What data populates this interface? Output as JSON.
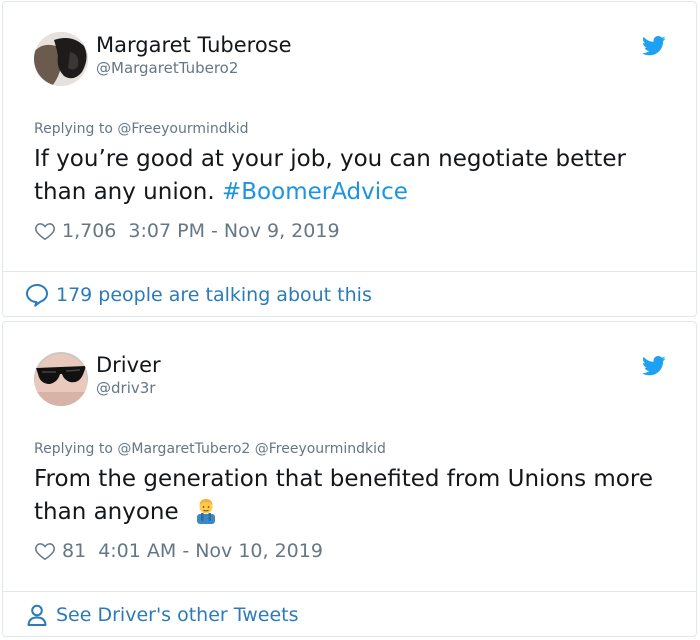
{
  "tweets": [
    {
      "display_name": "Margaret Tuberose",
      "handle": "@MargaretTubero2",
      "replying_label": "Replying to",
      "replying_to": "@Freeyourmindkid",
      "text": "If you’re good at your job, you can negotiate better than any union.",
      "hashtag": "#BoomerAdvice",
      "likes": "1,706",
      "timestamp": "3:07 PM - Nov 9, 2019",
      "footer": "179 people are talking about this",
      "footer_icon": "speech-bubble-icon"
    },
    {
      "display_name": "Driver",
      "handle": "@driv3r",
      "replying_label": "Replying to",
      "replying_to": "@MargaretTubero2 @Freeyourmindkid",
      "text": "From the generation that benefited from Unions more than anyone",
      "emoji": "man-farmer-emoji",
      "likes": "81",
      "timestamp": "4:01 AM - Nov 10, 2019",
      "footer": "See Driver's other Tweets",
      "footer_icon": "person-icon"
    }
  ],
  "colors": {
    "twitter_blue": "#1da1f2",
    "link_blue": "#2b7bb9",
    "hashtag_blue": "#1b95e0",
    "muted_gray": "#657786",
    "border": "#e1e8ed"
  }
}
